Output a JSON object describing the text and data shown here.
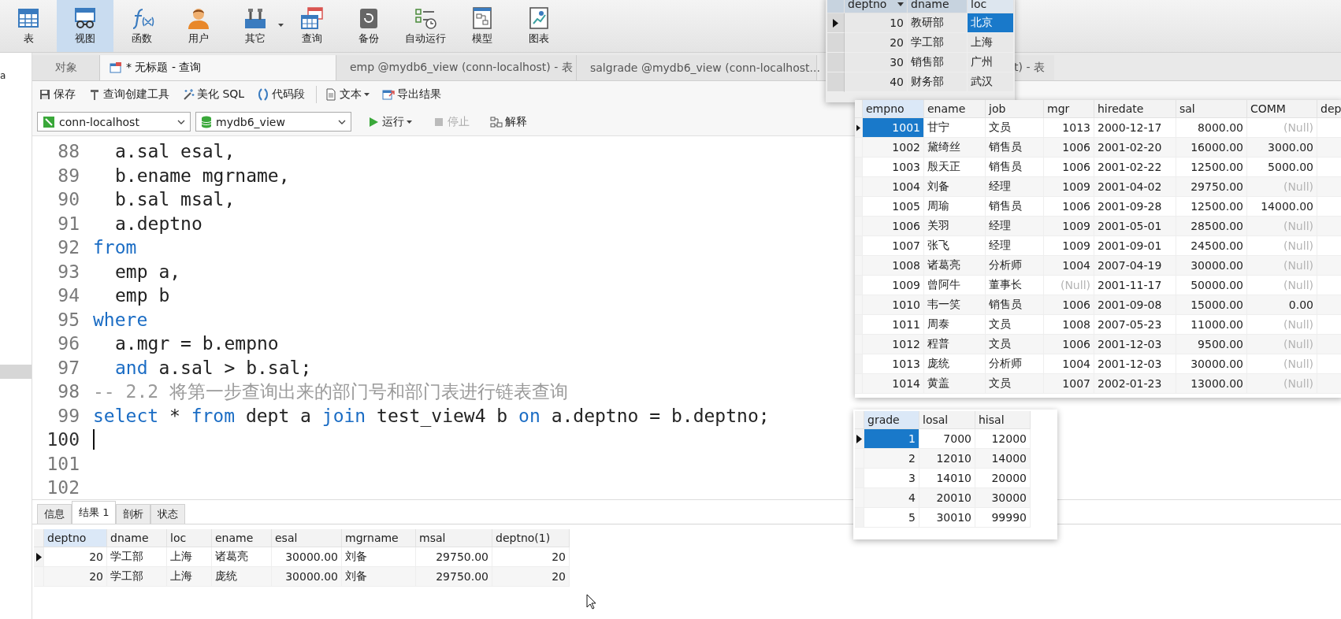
{
  "toolbar": [
    {
      "label": "表",
      "kind": "table",
      "selected": false,
      "dropdown": false
    },
    {
      "label": "视图",
      "kind": "view",
      "selected": true,
      "dropdown": false
    },
    {
      "label": "函数",
      "kind": "function",
      "selected": false,
      "dropdown": false
    },
    {
      "label": "用户",
      "kind": "user",
      "selected": false,
      "dropdown": false
    },
    {
      "label": "其它",
      "kind": "tools",
      "selected": false,
      "dropdown": true
    },
    {
      "label": "查询",
      "kind": "query",
      "selected": false,
      "dropdown": false
    },
    {
      "label": "备份",
      "kind": "backup",
      "selected": false,
      "dropdown": false
    },
    {
      "label": "自动运行",
      "kind": "schedule",
      "selected": false,
      "dropdown": false
    },
    {
      "label": "模型",
      "kind": "model",
      "selected": false,
      "dropdown": false
    },
    {
      "label": "图表",
      "kind": "chart",
      "selected": false,
      "dropdown": false
    }
  ],
  "sidebar": {
    "text": "a"
  },
  "tabs": [
    {
      "label": "对象",
      "kind": "objects",
      "selected": false
    },
    {
      "label": "* 无标题 - 查询",
      "kind": "query",
      "selected": true
    },
    {
      "label": "emp @mydb6_view (conn-localhost) - 表",
      "kind": "table",
      "selected": false
    },
    {
      "label": "salgrade @mydb6_view (conn-localhost...",
      "kind": "table",
      "selected": false
    },
    {
      "label": "t) - 表",
      "kind": "partial",
      "selected": false
    }
  ],
  "query_toolbar": [
    {
      "label": "保存",
      "kind": "save",
      "dropdown": false
    },
    {
      "label": "查询创建工具",
      "kind": "builder",
      "dropdown": false
    },
    {
      "label": "美化 SQL",
      "kind": "beautify",
      "dropdown": false
    },
    {
      "label": "代码段",
      "kind": "snippet",
      "dropdown": false
    },
    {
      "label": "文本",
      "kind": "text",
      "dropdown": true
    },
    {
      "label": "导出结果",
      "kind": "export",
      "dropdown": false
    }
  ],
  "connection": "conn-localhost",
  "database": "mydb6_view",
  "actions": [
    {
      "label": "运行",
      "kind": "run",
      "dropdown": true,
      "disabled": false
    },
    {
      "label": "停止",
      "kind": "stop",
      "dropdown": false,
      "disabled": true
    },
    {
      "label": "解释",
      "kind": "explain",
      "dropdown": false,
      "disabled": false
    }
  ],
  "editor": {
    "lines": [
      {
        "number": "88",
        "caret": false,
        "indent": true,
        "tokens": [
          {
            "kind": "plain",
            "text": "a.sal esal,"
          }
        ]
      },
      {
        "number": "89",
        "caret": false,
        "indent": true,
        "tokens": [
          {
            "kind": "plain",
            "text": "b.ename mgrname,"
          }
        ]
      },
      {
        "number": "90",
        "caret": false,
        "indent": true,
        "tokens": [
          {
            "kind": "plain",
            "text": "b.sal msal,"
          }
        ]
      },
      {
        "number": "91",
        "caret": false,
        "indent": true,
        "tokens": [
          {
            "kind": "plain",
            "text": "a.deptno"
          }
        ]
      },
      {
        "number": "92",
        "caret": false,
        "indent": false,
        "tokens": [
          {
            "kind": "keyword",
            "text": "from"
          }
        ]
      },
      {
        "number": "93",
        "caret": false,
        "indent": true,
        "tokens": [
          {
            "kind": "plain",
            "text": "emp a,"
          }
        ]
      },
      {
        "number": "94",
        "caret": false,
        "indent": true,
        "tokens": [
          {
            "kind": "plain",
            "text": "emp b"
          }
        ]
      },
      {
        "number": "95",
        "caret": false,
        "indent": false,
        "tokens": [
          {
            "kind": "keyword",
            "text": "where"
          }
        ]
      },
      {
        "number": "96",
        "caret": false,
        "indent": true,
        "tokens": [
          {
            "kind": "plain",
            "text": "a.mgr = b.empno"
          }
        ]
      },
      {
        "number": "97",
        "caret": false,
        "indent": true,
        "tokens": [
          {
            "kind": "keyword",
            "text": "and"
          },
          {
            "kind": "plain",
            "text": " a.sal > b.sal;"
          }
        ]
      },
      {
        "number": "98",
        "caret": false,
        "indent": false,
        "tokens": [
          {
            "kind": "comment",
            "text": "-- 2.2 将第一步查询出来的部门号和部门表进行链表查询"
          }
        ]
      },
      {
        "number": "99",
        "caret": false,
        "indent": false,
        "tokens": [
          {
            "kind": "keyword",
            "text": "select"
          },
          {
            "kind": "plain",
            "text": " * "
          },
          {
            "kind": "keyword",
            "text": "from"
          },
          {
            "kind": "plain",
            "text": " dept a "
          },
          {
            "kind": "keyword",
            "text": "join"
          },
          {
            "kind": "plain",
            "text": " test_view4 b "
          },
          {
            "kind": "keyword",
            "text": "on"
          },
          {
            "kind": "plain",
            "text": " a.deptno = b.deptno;"
          }
        ]
      },
      {
        "number": "100",
        "caret": true
      },
      {
        "number": "101",
        "caret": false
      },
      {
        "number": "102",
        "caret": false
      }
    ]
  },
  "result_tabs": [
    {
      "label": "信息",
      "selected": false
    },
    {
      "label": "结果 1",
      "selected": true
    },
    {
      "label": "剖析",
      "selected": false
    },
    {
      "label": "状态",
      "selected": false
    }
  ],
  "result_grid": {
    "focused": false,
    "columns": [
      {
        "label": "deptno",
        "kind": "number",
        "selected": true,
        "sorted": false
      },
      {
        "label": "dname",
        "kind": "text",
        "selected": false,
        "sorted": false
      },
      {
        "label": "loc",
        "kind": "text",
        "selected": false,
        "sorted": false
      },
      {
        "label": "ename",
        "kind": "text",
        "selected": false,
        "sorted": false
      },
      {
        "label": "esal",
        "kind": "number",
        "selected": false,
        "sorted": false
      },
      {
        "label": "mgrname",
        "kind": "text",
        "selected": false,
        "sorted": false
      },
      {
        "label": "msal",
        "kind": "number",
        "selected": false,
        "sorted": false
      },
      {
        "label": "deptno(1)",
        "kind": "number",
        "selected": false,
        "sorted": false
      }
    ],
    "rows": [
      {
        "selected": true,
        "cells": [
          "20",
          "学工部",
          "上海",
          "诸葛亮",
          "30000.00",
          "刘备",
          "29750.00",
          "20"
        ]
      },
      {
        "selected": false,
        "cells": [
          "20",
          "学工部",
          "上海",
          "庞统",
          "30000.00",
          "刘备",
          "29750.00",
          "20"
        ]
      }
    ]
  },
  "dept_window": {
    "focused": true,
    "columns": [
      {
        "label": "deptno",
        "kind": "number",
        "selected": false,
        "sorted": true
      },
      {
        "label": "dname",
        "kind": "text",
        "selected": false,
        "sorted": false
      },
      {
        "label": "loc",
        "kind": "text",
        "selected": true,
        "sorted": false
      }
    ],
    "rows": [
      {
        "selected": true,
        "cells": [
          "10",
          "教研部",
          "北京"
        ]
      },
      {
        "selected": false,
        "cells": [
          "20",
          "学工部",
          "上海"
        ]
      },
      {
        "selected": false,
        "cells": [
          "30",
          "销售部",
          "广州"
        ]
      },
      {
        "selected": false,
        "cells": [
          "40",
          "财务部",
          "武汉"
        ]
      }
    ]
  },
  "emp_window": {
    "focused": true,
    "columns": [
      {
        "label": "empno",
        "kind": "number",
        "selected": true,
        "sorted": false
      },
      {
        "label": "ename",
        "kind": "text",
        "selected": false,
        "sorted": false
      },
      {
        "label": "job",
        "kind": "text",
        "selected": false,
        "sorted": false
      },
      {
        "label": "mgr",
        "kind": "number",
        "selected": false,
        "sorted": false
      },
      {
        "label": "hiredate",
        "kind": "text",
        "selected": false,
        "sorted": false
      },
      {
        "label": "sal",
        "kind": "number",
        "selected": false,
        "sorted": false
      },
      {
        "label": "COMM",
        "kind": "number",
        "selected": false,
        "sorted": false
      },
      {
        "label": "dep",
        "selected": false,
        "sorted": false
      }
    ],
    "rows": [
      {
        "selected": true,
        "cells": [
          "1001",
          "甘宁",
          "文员",
          "1013",
          "2000-12-17",
          "8000.00",
          {
            "text": "(Null)",
            "kind": "null"
          }
        ]
      },
      {
        "selected": false,
        "cells": [
          "1002",
          "黛绮丝",
          "销售员",
          "1006",
          "2001-02-20",
          "16000.00",
          "3000.00"
        ]
      },
      {
        "selected": false,
        "cells": [
          "1003",
          "殷天正",
          "销售员",
          "1006",
          "2001-02-22",
          "12500.00",
          "5000.00"
        ]
      },
      {
        "selected": false,
        "cells": [
          "1004",
          "刘备",
          "经理",
          "1009",
          "2001-04-02",
          "29750.00",
          {
            "text": "(Null)",
            "kind": "null"
          }
        ]
      },
      {
        "selected": false,
        "cells": [
          "1005",
          "周瑜",
          "销售员",
          "1006",
          "2001-09-28",
          "12500.00",
          "14000.00"
        ]
      },
      {
        "selected": false,
        "cells": [
          "1006",
          "关羽",
          "经理",
          "1009",
          "2001-05-01",
          "28500.00",
          {
            "text": "(Null)",
            "kind": "null"
          }
        ]
      },
      {
        "selected": false,
        "cells": [
          "1007",
          "张飞",
          "经理",
          "1009",
          "2001-09-01",
          "24500.00",
          {
            "text": "(Null)",
            "kind": "null"
          }
        ]
      },
      {
        "selected": false,
        "cells": [
          "1008",
          "诸葛亮",
          "分析师",
          "1004",
          "2007-04-19",
          "30000.00",
          {
            "text": "(Null)",
            "kind": "null"
          }
        ]
      },
      {
        "selected": false,
        "cells": [
          "1009",
          "曾阿牛",
          "董事长",
          {
            "text": "(Null)",
            "kind": "null"
          },
          "2001-11-17",
          "50000.00",
          {
            "text": "(Null)",
            "kind": "null"
          }
        ]
      },
      {
        "selected": false,
        "cells": [
          "1010",
          "韦一笑",
          "销售员",
          "1006",
          "2001-09-08",
          "15000.00",
          "0.00"
        ]
      },
      {
        "selected": false,
        "cells": [
          "1011",
          "周泰",
          "文员",
          "1008",
          "2007-05-23",
          "11000.00",
          {
            "text": "(Null)",
            "kind": "null"
          }
        ]
      },
      {
        "selected": false,
        "cells": [
          "1012",
          "程普",
          "文员",
          "1006",
          "2001-12-03",
          "9500.00",
          {
            "text": "(Null)",
            "kind": "null"
          }
        ]
      },
      {
        "selected": false,
        "cells": [
          "1013",
          "庞统",
          "分析师",
          "1004",
          "2001-12-03",
          "30000.00",
          {
            "text": "(Null)",
            "kind": "null"
          }
        ]
      },
      {
        "selected": false,
        "cells": [
          "1014",
          "黄盖",
          "文员",
          "1007",
          "2002-01-23",
          "13000.00",
          {
            "text": "(Null)",
            "kind": "null"
          }
        ]
      }
    ]
  },
  "salgrade_window": {
    "focused": true,
    "columns": [
      {
        "label": "grade",
        "kind": "number",
        "selected": true,
        "sorted": false
      },
      {
        "label": "losal",
        "kind": "number",
        "selected": false,
        "sorted": false
      },
      {
        "label": "hisal",
        "kind": "number",
        "selected": false,
        "sorted": false
      }
    ],
    "rows": [
      {
        "selected": true,
        "cells": [
          "1",
          "7000",
          "12000"
        ]
      },
      {
        "selected": false,
        "cells": [
          "2",
          "12010",
          "14000"
        ]
      },
      {
        "selected": false,
        "cells": [
          "3",
          "14010",
          "20000"
        ]
      },
      {
        "selected": false,
        "cells": [
          "4",
          "20010",
          "30000"
        ]
      },
      {
        "selected": false,
        "cells": [
          "5",
          "30010",
          "99990"
        ]
      }
    ]
  }
}
